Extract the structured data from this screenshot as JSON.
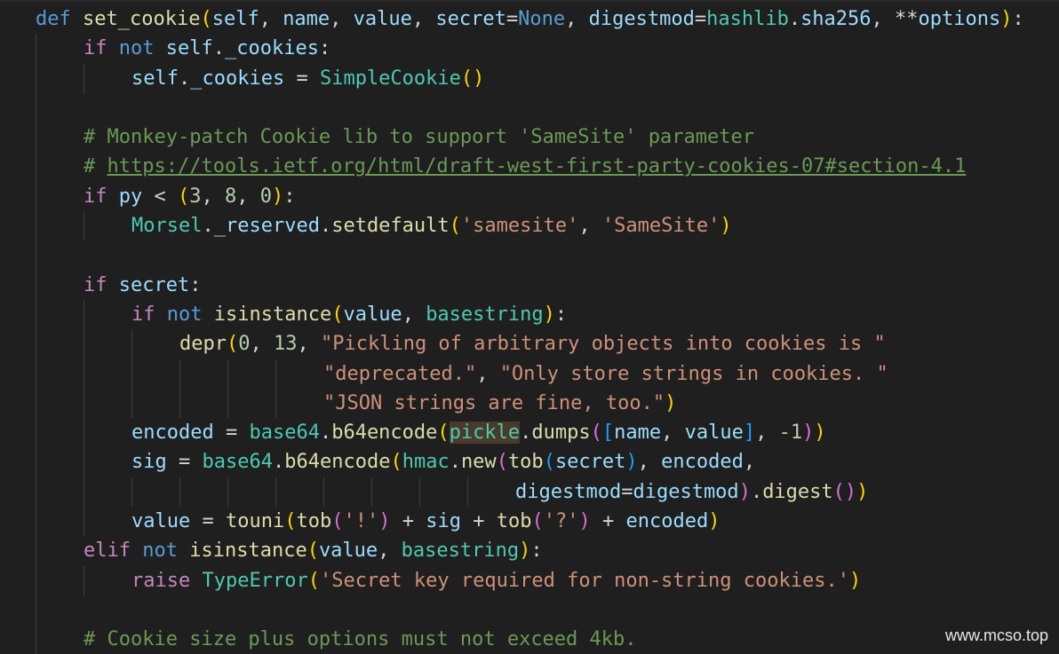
{
  "code_lines": [
    "def set_cookie(self, name, value, secret=None, digestmod=hashlib.sha256, **options):",
    "    if not self._cookies:",
    "        self._cookies = SimpleCookie()",
    "",
    "    # Monkey-patch Cookie lib to support 'SameSite' parameter",
    "    # https://tools.ietf.org/html/draft-west-first-party-cookies-07#section-4.1",
    "    if py < (3, 8, 0):",
    "        Morsel._reserved.setdefault('samesite', 'SameSite')",
    "",
    "    if secret:",
    "        if not isinstance(value, basestring):",
    "            depr(0, 13, \"Pickling of arbitrary objects into cookies is \"",
    "                        \"deprecated.\", \"Only store strings in cookies. \"",
    "                        \"JSON strings are fine, too.\")",
    "        encoded = base64.b64encode(pickle.dumps([name, value], -1))",
    "        sig = base64.b64encode(hmac.new(tob(secret), encoded,",
    "                                        digestmod=digestmod).digest())",
    "        value = touni(tob('!') + sig + tob('?') + encoded)",
    "    elif not isinstance(value, basestring):",
    "        raise TypeError('Secret key required for non-string cookies.')",
    "",
    "    # Cookie size plus options must not exceed 4kb."
  ],
  "watermark": "www.mcso.top"
}
